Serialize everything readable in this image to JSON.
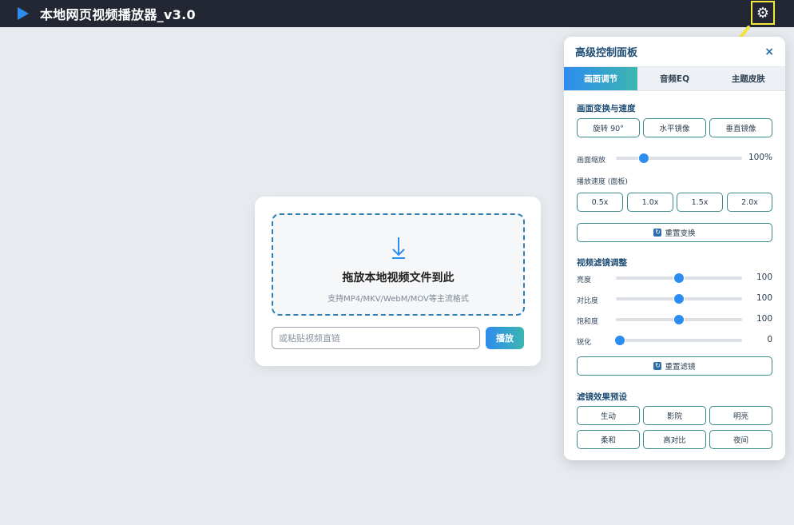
{
  "app": {
    "title": "本地网页视频播放器_v3.0"
  },
  "drop": {
    "title": "拖放本地视频文件到此",
    "subtitle": "支持MP4/MKV/WebM/MOV等主流格式",
    "url_placeholder": "或粘贴视频直链",
    "play_label": "播放"
  },
  "panel": {
    "title": "高级控制面板",
    "close": "×",
    "tabs": [
      {
        "label": "画面调节"
      },
      {
        "label": "音频EQ"
      },
      {
        "label": "主题皮肤"
      }
    ],
    "transform": {
      "title": "画面变换与速度",
      "buttons": [
        {
          "label": "旋转 90°"
        },
        {
          "label": "水平镜像"
        },
        {
          "label": "垂直镜像"
        }
      ],
      "zoom": {
        "label": "画面缩放",
        "value": 0.22,
        "display": "100%"
      },
      "speed_label": "播放速度 (面板)",
      "speeds": [
        {
          "label": "0.5x"
        },
        {
          "label": "1.0x"
        },
        {
          "label": "1.5x"
        },
        {
          "label": "2.0x"
        }
      ],
      "reset": "重置变换"
    },
    "filters": {
      "title": "视频滤镜调整",
      "items": [
        {
          "label": "亮度",
          "value": 0.5,
          "display": "100"
        },
        {
          "label": "对比度",
          "value": 0.5,
          "display": "100"
        },
        {
          "label": "饱和度",
          "value": 0.5,
          "display": "100"
        },
        {
          "label": "锐化",
          "value": 0.03,
          "display": "0"
        }
      ],
      "reset": "重置滤镜"
    },
    "presets": {
      "title": "滤镜效果预设",
      "items": [
        {
          "label": "生动"
        },
        {
          "label": "影院"
        },
        {
          "label": "明亮"
        },
        {
          "label": "柔和"
        },
        {
          "label": "高对比"
        },
        {
          "label": "夜间"
        }
      ]
    }
  },
  "colors": {
    "accent": "#2d8cf0",
    "accent2": "#3db6b0",
    "topbar": "#232733",
    "highlight": "#f5e83b"
  }
}
